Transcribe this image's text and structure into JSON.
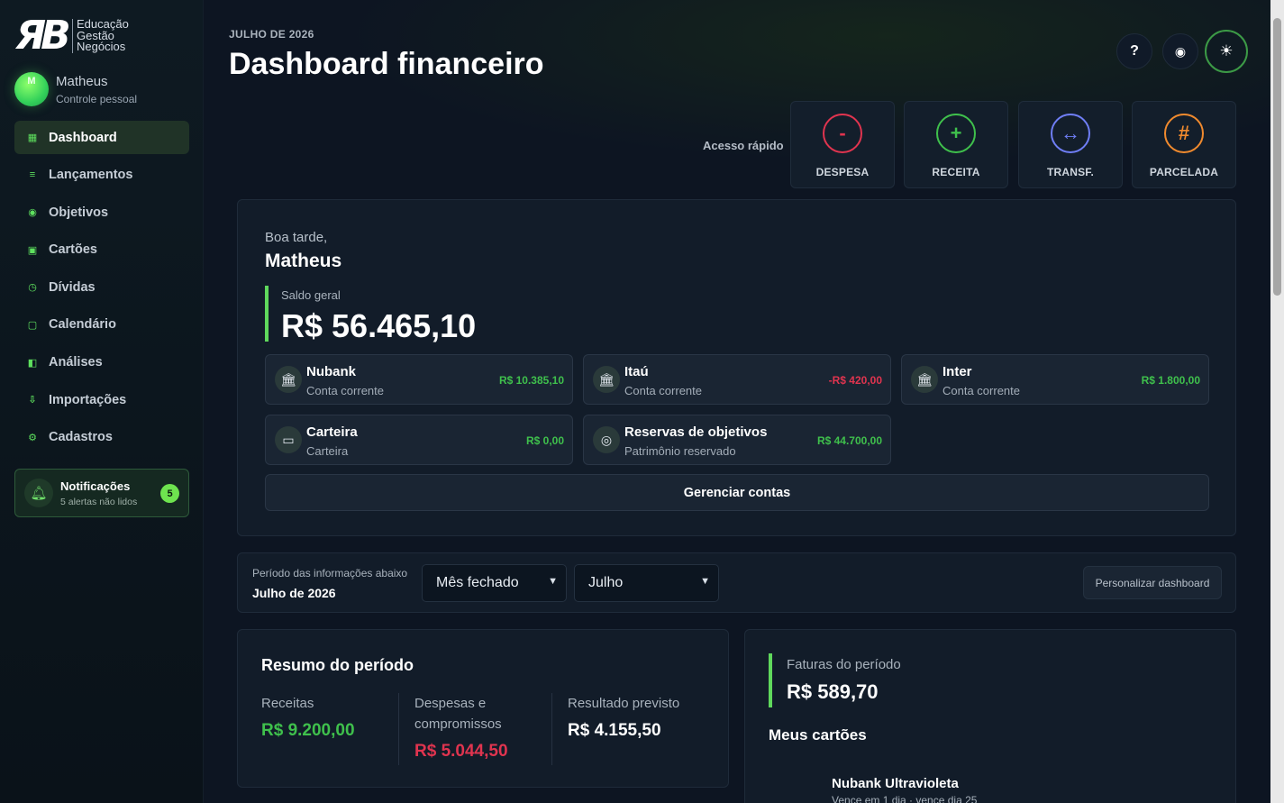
{
  "brand": {
    "logo_mark": "ЯB",
    "lines": [
      "Educação",
      "Gestão",
      "Negócios"
    ]
  },
  "user": {
    "initial": "M",
    "name": "Matheus",
    "subtitle": "Controle pessoal"
  },
  "nav": [
    {
      "label": "Dashboard",
      "icon": "▦",
      "active": true
    },
    {
      "label": "Lançamentos",
      "icon": "≡"
    },
    {
      "label": "Objetivos",
      "icon": "◉"
    },
    {
      "label": "Cartões",
      "icon": "▣"
    },
    {
      "label": "Dívidas",
      "icon": "◷"
    },
    {
      "label": "Calendário",
      "icon": "▢"
    },
    {
      "label": "Análises",
      "icon": "◧"
    },
    {
      "label": "Importações",
      "icon": "⇩"
    },
    {
      "label": "Cadastros",
      "icon": "⚙"
    }
  ],
  "notifications": {
    "title": "Notificações",
    "subtitle": "5 alertas não lidos",
    "count": "5"
  },
  "header": {
    "month": "JULHO DE 2026",
    "title": "Dashboard financeiro",
    "help": "?",
    "eye": "◉",
    "theme": "☀"
  },
  "quick": {
    "label": "Acesso rápido",
    "items": [
      {
        "symbol": "-",
        "label": "DESPESA",
        "color": "#e0344f"
      },
      {
        "symbol": "+",
        "label": "RECEITA",
        "color": "#3fc04c"
      },
      {
        "symbol": "↔",
        "label": "TRANSF.",
        "color": "#6f7ef5"
      },
      {
        "symbol": "#",
        "label": "PARCELADA",
        "color": "#f08a2e"
      }
    ]
  },
  "balance": {
    "greeting": "Boa tarde,",
    "name": "Matheus",
    "label": "Saldo geral",
    "value": "R$ 56.465,10"
  },
  "accounts": [
    {
      "name": "Nubank",
      "type": "Conta corrente",
      "value": "R$ 10.385,10",
      "color": "#3fc04c",
      "icon": "🏛"
    },
    {
      "name": "Itaú",
      "type": "Conta corrente",
      "value": "-R$ 420,00",
      "color": "#e0344f",
      "icon": "🏛"
    },
    {
      "name": "Inter",
      "type": "Conta corrente",
      "value": "R$ 1.800,00",
      "color": "#3fc04c",
      "icon": "🏛"
    },
    {
      "name": "Carteira",
      "type": "Carteira",
      "value": "R$ 0,00",
      "color": "#3fc04c",
      "icon": "▭"
    },
    {
      "name": "Reservas de objetivos",
      "type": "Patrimônio reservado",
      "value": "R$ 44.700,00",
      "color": "#3fc04c",
      "icon": "◎"
    }
  ],
  "manage_label": "Gerenciar contas",
  "period": {
    "label": "Período das informações abaixo",
    "value": "Julho de 2026",
    "mode": "Mês fechado",
    "month": "Julho",
    "customize": "Personalizar dashboard"
  },
  "summary": {
    "title": "Resumo do período",
    "income_label": "Receitas",
    "income": "R$ 9.200,00",
    "expenses_label_1": "Despesas e",
    "expenses_label_2": "compromissos",
    "expenses": "R$ 5.044,50",
    "result_label": "Resultado previsto",
    "result": "R$ 4.155,50"
  },
  "invoices": {
    "label": "Faturas do período",
    "value": "R$ 589,70",
    "my_cards": "Meus cartões",
    "card_name": "Nubank Ultravioleta",
    "card_due": "Vence em 1 dia · vence dia 25"
  },
  "colors": {
    "accent": "#5fd85c",
    "negative": "#e0344f",
    "background": "#0d1522"
  }
}
